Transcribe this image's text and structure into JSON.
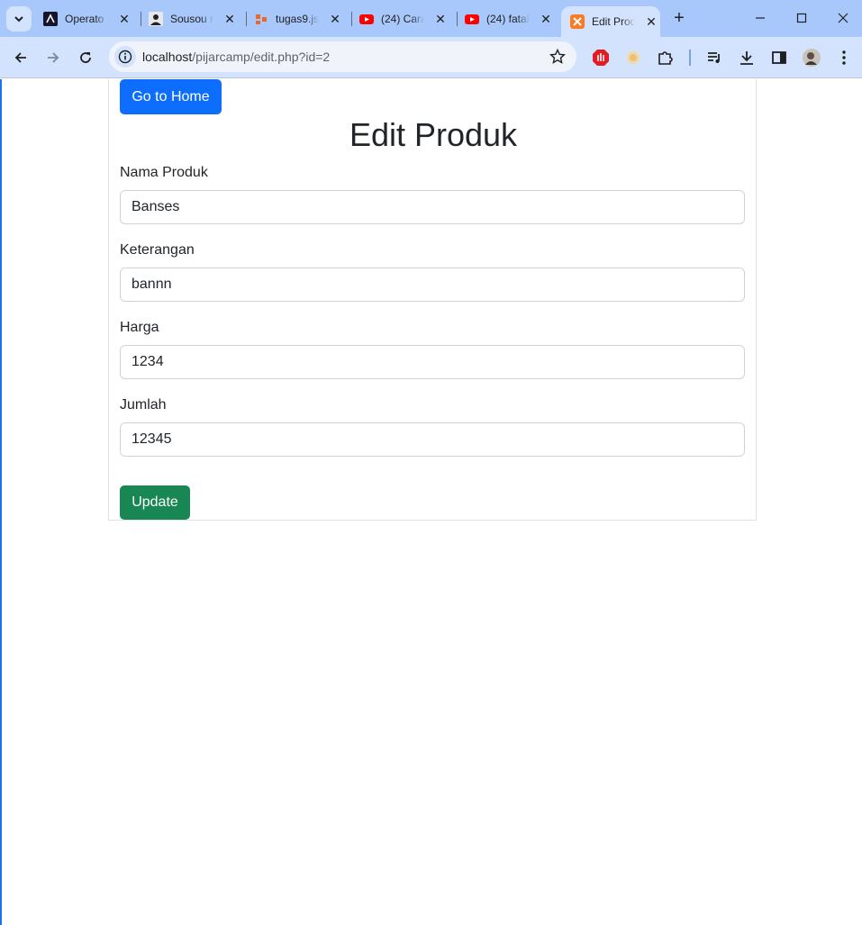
{
  "browser": {
    "tabs": [
      {
        "title": "Operato",
        "icon": "operator-icon"
      },
      {
        "title": "Sousou n",
        "icon": "user-icon"
      },
      {
        "title": "tugas9.js",
        "icon": "gitlab-icon"
      },
      {
        "title": "(24) Cara",
        "icon": "youtube-icon"
      },
      {
        "title": "(24) fatal",
        "icon": "youtube-icon"
      },
      {
        "title": "Edit Prod",
        "icon": "xampp-icon",
        "active": true
      }
    ],
    "new_tab": "+",
    "address": {
      "host": "localhost",
      "path": "/pijarcamp/edit.php?id=2"
    },
    "accent": "#a8c7fa"
  },
  "page": {
    "home_button": "Go to Home",
    "title": "Edit Produk",
    "fields": [
      {
        "label": "Nama Produk",
        "value": "Banses"
      },
      {
        "label": "Keterangan",
        "value": "bannn"
      },
      {
        "label": "Harga",
        "value": "1234"
      },
      {
        "label": "Jumlah",
        "value": "12345"
      }
    ],
    "update_button": "Update",
    "colors": {
      "primary": "#0d6efd",
      "success": "#198754"
    }
  }
}
